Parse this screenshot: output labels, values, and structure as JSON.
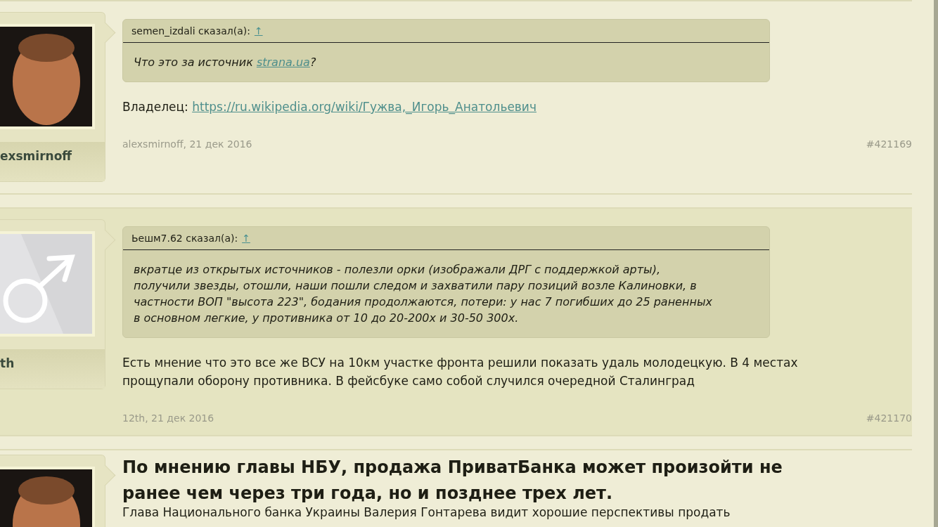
{
  "posts": [
    {
      "highlighted": false,
      "avatar": {
        "kind": "figure"
      },
      "username": "exsmirnoff",
      "quote": {
        "author": "semen_izdali сказал(а):",
        "jump": "↑",
        "segments": [
          {
            "text": "Что это за источник ",
            "link": false
          },
          {
            "text": "strana.ua",
            "link": true
          },
          {
            "text": "?",
            "link": false
          }
        ]
      },
      "body": [
        {
          "text": "Владелец: ",
          "link": false
        },
        {
          "text": "https://ru.wikipedia.org/wiki/Гужва,_Игорь_Анатольевич",
          "link": true
        }
      ],
      "meta": "alexsmirnoff, 21 дек 2016",
      "number": "#421169"
    },
    {
      "highlighted": true,
      "avatar": {
        "kind": "male"
      },
      "username": "th",
      "quote": {
        "author": "Ьешм7.62 сказал(а):",
        "jump": "↑",
        "segments": [
          {
            "text": "вкратце из открытых источников - полезли орки (изображали ДРГ с поддержкой арты), получили звезды, отошли, наши пошли следом и захватили пару позиций возле Калиновки, в частности ВОП \"высота 223\", бодания продолжаются, потери: у нас 7 погибших до 25 раненных в основном легкие, у противника от 10 до 20-200х и 30-50 300х.",
            "link": false
          }
        ]
      },
      "body": [
        {
          "text": "Есть мнение что это все же ВСУ на 10км участке фронта решили показать удаль молодецкую. В 4 местах прощупали оборону противника. В фейсбуке само собой случился очередной Сталинград",
          "link": false
        }
      ],
      "meta": "12th, 21 дек 2016",
      "number": "#421170"
    }
  ],
  "article": {
    "avatar": {
      "kind": "figure"
    },
    "title": "По мнению главы НБУ, продажа ПриватБанка может произойти не ранее чем через три года, но и позднее трех лет.",
    "lead": "Глава Национального банка Украины Валерия Гонтарева видит хорошие перспективы продать"
  }
}
